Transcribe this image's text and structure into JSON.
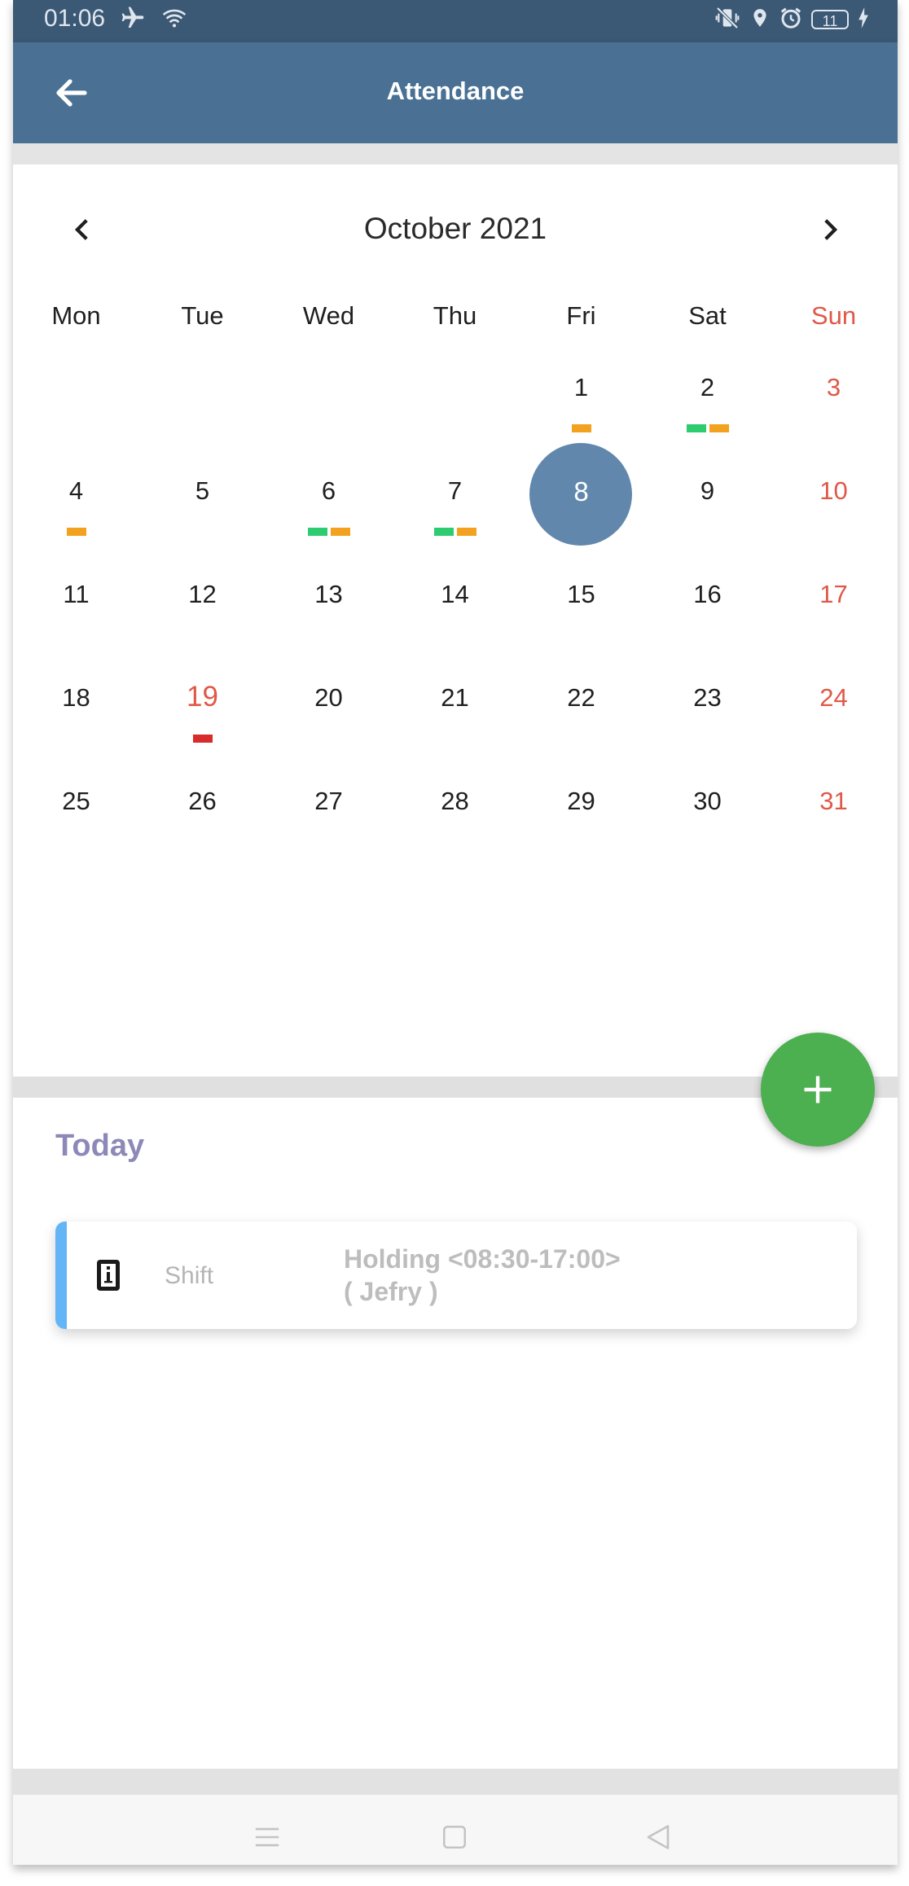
{
  "status_bar": {
    "time": "01:06",
    "battery": "11"
  },
  "app_bar": {
    "title": "Attendance"
  },
  "calendar": {
    "month_title": "October 2021",
    "weekdays": [
      "Mon",
      "Tue",
      "Wed",
      "Thu",
      "Fri",
      "Sat",
      "Sun"
    ],
    "selected_day": "8",
    "weeks": [
      [
        null,
        null,
        null,
        null,
        {
          "day": "1",
          "marks": [
            "orange"
          ]
        },
        {
          "day": "2",
          "marks": [
            "green",
            "orange"
          ]
        },
        {
          "day": "3",
          "sun": true
        }
      ],
      [
        {
          "day": "4",
          "marks": [
            "orange"
          ]
        },
        {
          "day": "5"
        },
        {
          "day": "6",
          "marks": [
            "green",
            "orange"
          ]
        },
        {
          "day": "7",
          "marks": [
            "green",
            "orange"
          ]
        },
        {
          "day": "8",
          "selected": true
        },
        {
          "day": "9"
        },
        {
          "day": "10",
          "sun": true
        }
      ],
      [
        {
          "day": "11"
        },
        {
          "day": "12"
        },
        {
          "day": "13"
        },
        {
          "day": "14"
        },
        {
          "day": "15"
        },
        {
          "day": "16"
        },
        {
          "day": "17",
          "sun": true
        }
      ],
      [
        {
          "day": "18"
        },
        {
          "day": "19",
          "red": true,
          "marks": [
            "red"
          ]
        },
        {
          "day": "20"
        },
        {
          "day": "21"
        },
        {
          "day": "22"
        },
        {
          "day": "23"
        },
        {
          "day": "24",
          "sun": true
        }
      ],
      [
        {
          "day": "25"
        },
        {
          "day": "26"
        },
        {
          "day": "27"
        },
        {
          "day": "28"
        },
        {
          "day": "29"
        },
        {
          "day": "30"
        },
        {
          "day": "31",
          "sun": true
        }
      ]
    ],
    "mark_colors": {
      "orange": "#f2a21f",
      "green": "#2ecc71",
      "red": "#d82b2b"
    }
  },
  "today": {
    "title": "Today",
    "entry": {
      "label": "Shift",
      "value_line1": "Holding <08:30-17:00>",
      "value_line2": "( Jefry )"
    }
  },
  "colors": {
    "app_bar": "#4a7194",
    "status_bar": "#3b5874",
    "fab": "#4caf50",
    "selected": "#6188ac",
    "sunday": "#e05848",
    "accent": "#64b5f6"
  }
}
